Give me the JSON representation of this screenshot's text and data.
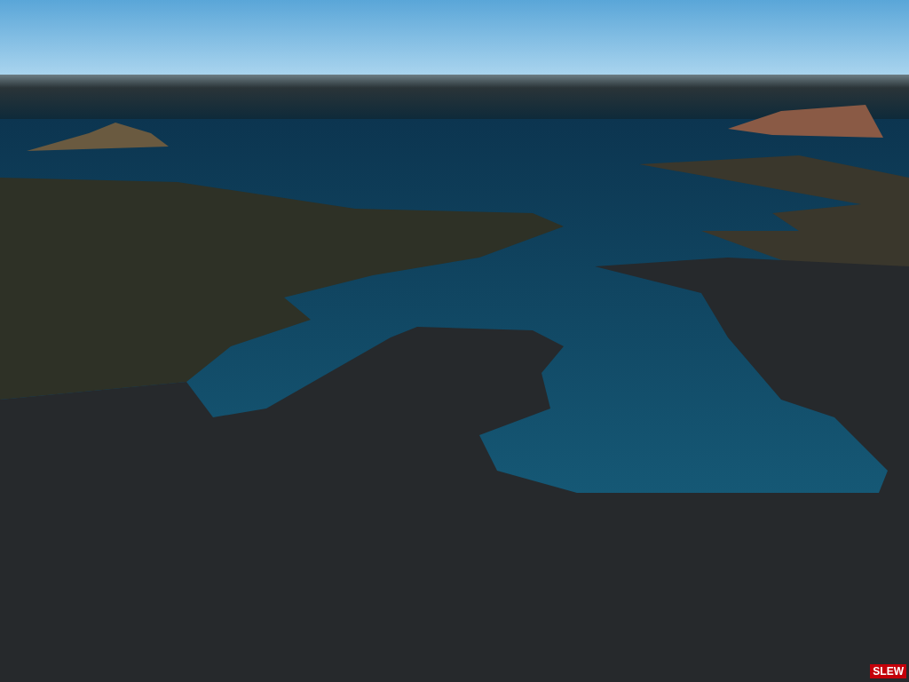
{
  "status_badge": {
    "text": "SLEW"
  }
}
